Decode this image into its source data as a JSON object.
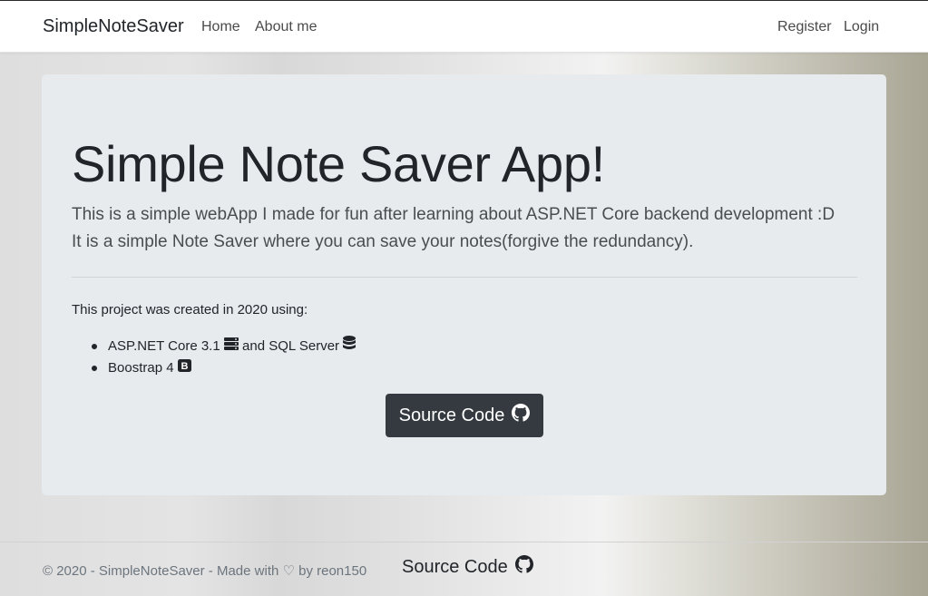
{
  "navbar": {
    "brand": "SimpleNoteSaver",
    "links": [
      "Home",
      "About me"
    ],
    "right_links": [
      "Register",
      "Login"
    ]
  },
  "hero": {
    "title": "Simple Note Saver App!",
    "lead_line1": "This is a simple webApp I made for fun after learning about ASP.NET Core backend development :D",
    "lead_line2": "It is a simple Note Saver where you can save your notes(forgive the redundancy).",
    "intro": "This project was created in 2020 using:",
    "tech_item1_a": "ASP.NET Core 3.1",
    "tech_item1_b": "and SQL Server",
    "tech_item2": "Boostrap 4",
    "source_button": "Source Code"
  },
  "footer": {
    "text": "© 2020 - SimpleNoteSaver - Made with ♡ by reon150",
    "source_link": "Source Code"
  },
  "icons": {
    "server": "server-icon",
    "database": "database-icon",
    "bootstrap": "bootstrap-icon",
    "github": "github-icon"
  },
  "colors": {
    "button_bg": "#343a40",
    "card_bg": "#e8ebee",
    "footer_text": "#6c757d"
  }
}
